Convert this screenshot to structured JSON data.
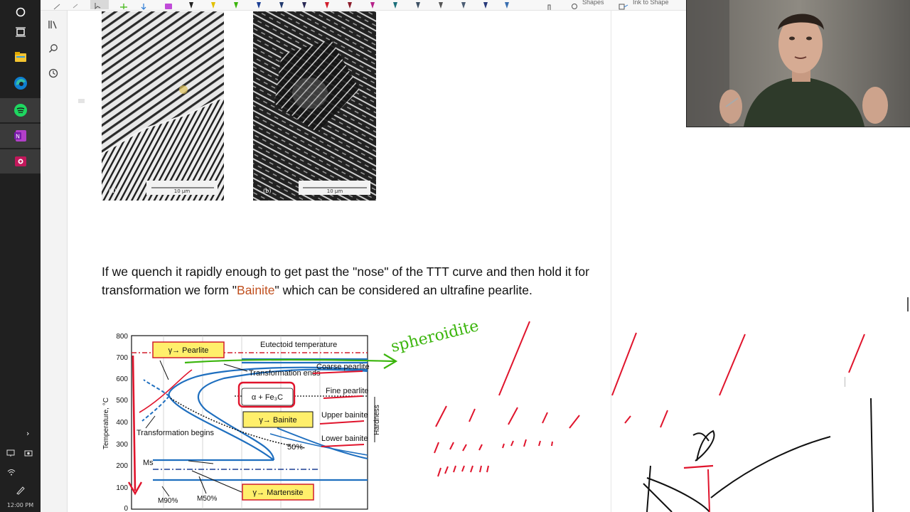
{
  "taskbar": {
    "apps": [
      {
        "name": "cortana"
      },
      {
        "name": "task-view"
      },
      {
        "name": "file-explorer"
      },
      {
        "name": "edge"
      },
      {
        "name": "spotify"
      },
      {
        "name": "onenote"
      },
      {
        "name": "webcam-app"
      }
    ],
    "clock": "12:00 PM"
  },
  "ribbon": {
    "shapes_label": "Shapes",
    "ink_to_shape_label": "Ink to Shape"
  },
  "page": {
    "paragraph_before": "If we quench it rapidly enough to get past the \"nose\" of the TTT curve and then hold it for transformation we form \"",
    "highlight_word": "Bainite",
    "paragraph_after": "\" which can be considered an ultrafine pearlite.",
    "micrograph_a_label": "(a)",
    "micrograph_b_label": "(b)",
    "scale_bar_label": "10 µm",
    "handwriting": "spheroidite"
  },
  "ttt_diagram": {
    "y_ticks": [
      "800",
      "700",
      "600",
      "500",
      "400",
      "300",
      "200",
      "100",
      "0"
    ],
    "ylabel": "Temperature, °C",
    "eutectoid_label": "Eutectoid temperature",
    "pearlite_box": "γ→ Pearlite",
    "trans_ends": "Transformation ends",
    "coarse_pearlite": "Coarse pearlite",
    "phase_box": "α + Fe₃C",
    "fine_pearlite": "Fine pearlite",
    "bainite_box": "γ→ Bainite",
    "upper_bainite": "Upper bainite",
    "trans_begins": "Transformation begins",
    "lower_bainite": "Lower bainite",
    "fifty_pct": "50%",
    "ms": "Ms",
    "m90": "M90%",
    "m50": "M50%",
    "martensite_box": "γ→ Martensite",
    "hardness": "Hardness"
  },
  "colors": {
    "bainite": "#c0501f",
    "ink_red": "#e0142c",
    "ink_green": "#3bb50c",
    "curve_blue": "#1f6fbf"
  }
}
